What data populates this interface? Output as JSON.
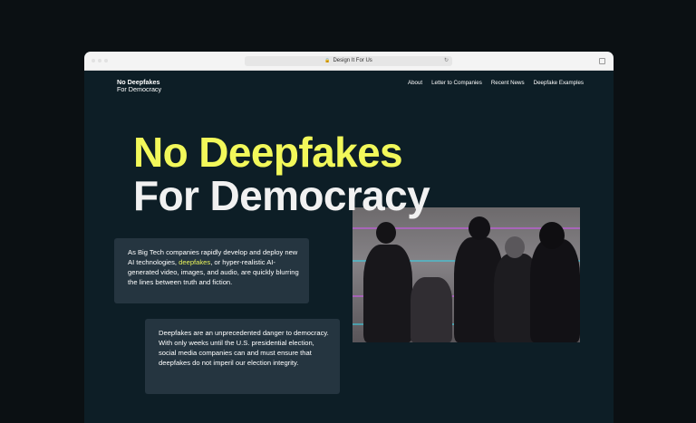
{
  "browser": {
    "url": "Design It For Us"
  },
  "site": {
    "logo_line1": "No Deepfakes",
    "logo_line2": "For Democracy",
    "nav": [
      {
        "label": "About"
      },
      {
        "label": "Letter to Companies"
      },
      {
        "label": "Recent News"
      },
      {
        "label": "Deepfake Examples"
      }
    ]
  },
  "hero": {
    "title_line1": "No Deepfakes",
    "title_line2": "For Democracy"
  },
  "card1": {
    "text_before": "As Big Tech companies rapidly develop and deploy new AI technologies, ",
    "highlight": "deepfakes",
    "text_after": ", or hyper-realistic AI-generated video, images, and audio, are quickly blurring the lines between truth and fiction."
  },
  "card2": {
    "text": "Deepfakes are an unprecedented danger to democracy. With only weeks until the U.S. presidential election, social media companies can and must ensure that deepfakes do not imperil our election integrity."
  },
  "colors": {
    "accent": "#f2f85a",
    "background": "#0d1e26",
    "card": "#253540"
  }
}
